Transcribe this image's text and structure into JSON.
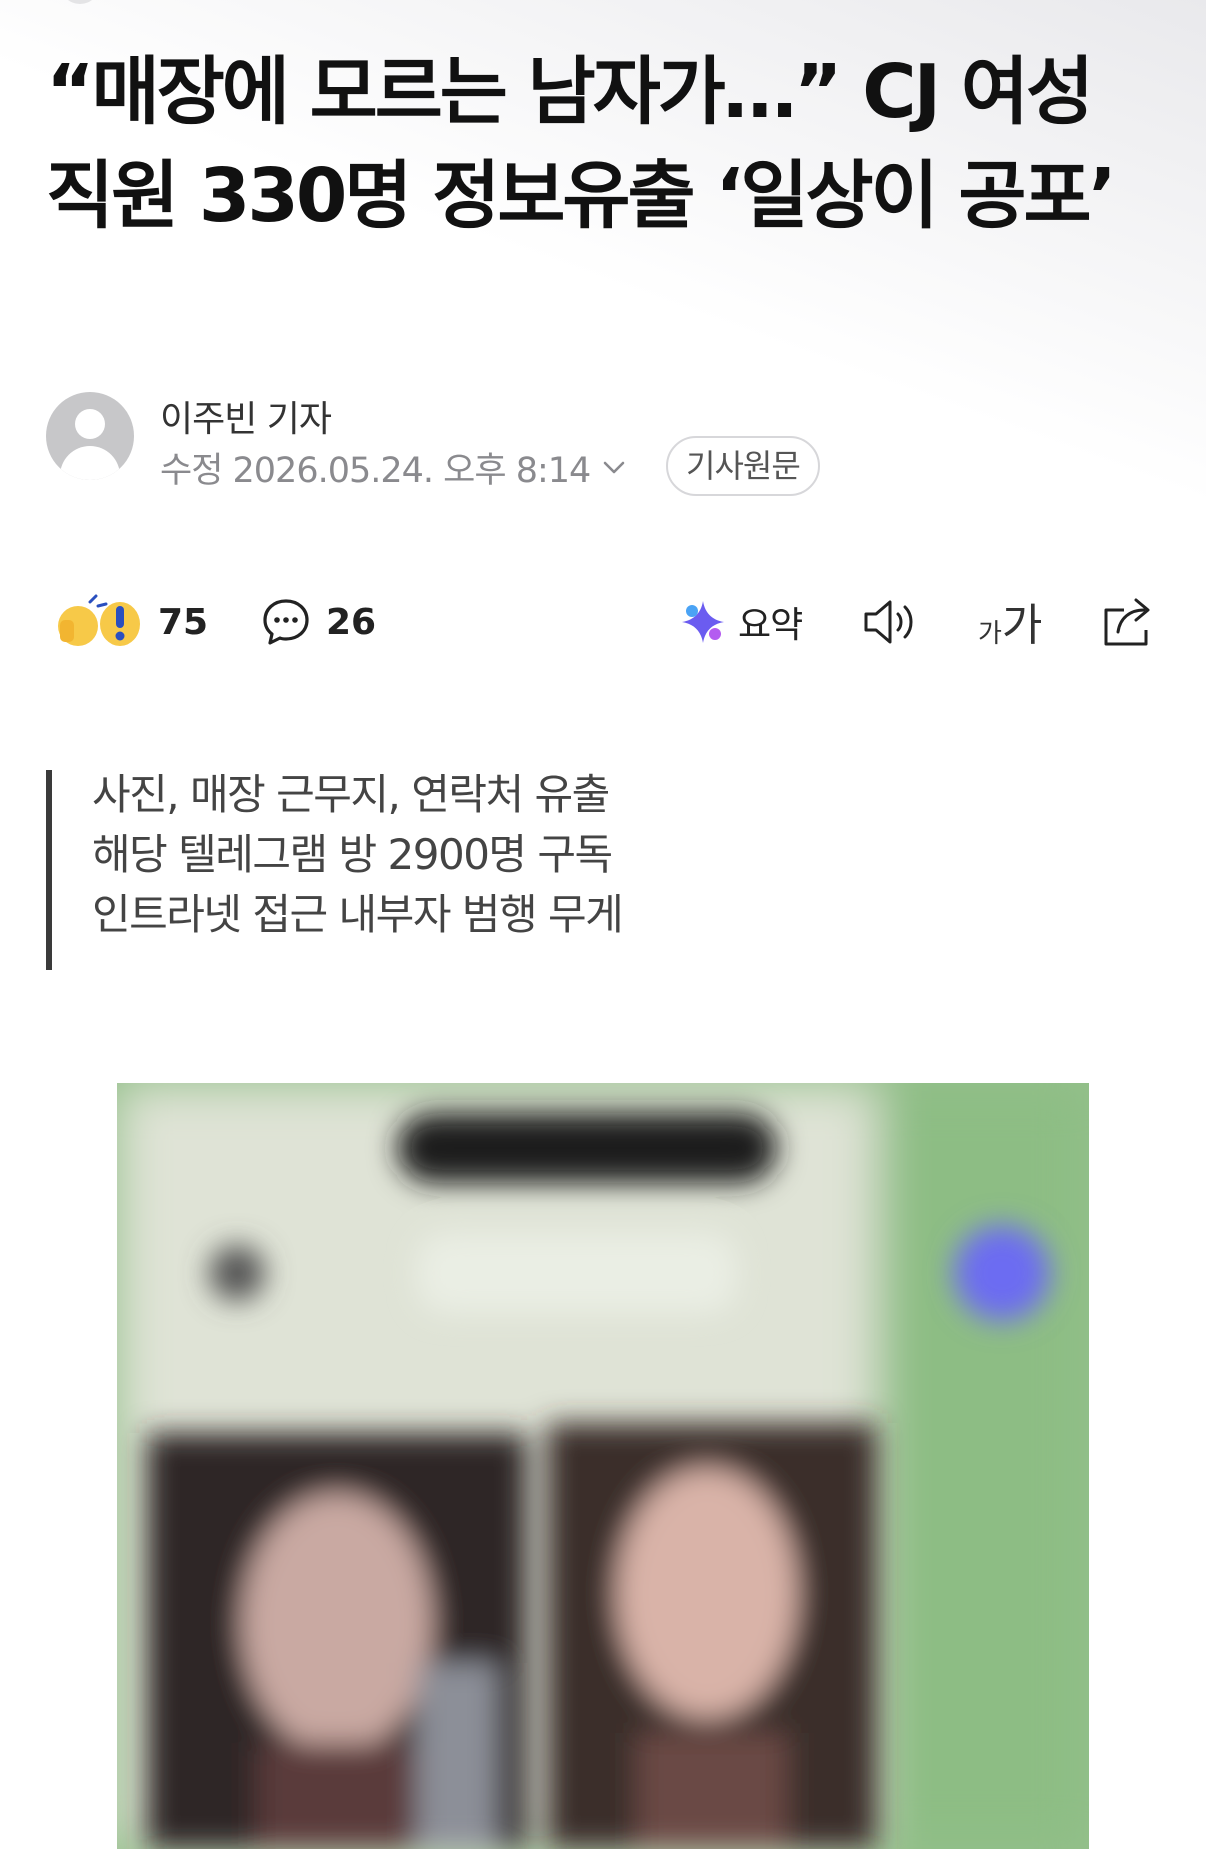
{
  "article": {
    "headline": "“매장에 모르는 남자가…” CJ 여성 직원 330명 정보유출 ‘일상이 공포’",
    "reporter": "이주빈 기자",
    "date": "수정 2026.05.24. 오후 8:14",
    "source_button": "기사원문"
  },
  "actions": {
    "reaction_count": "75",
    "comment_count": "26",
    "summary_label": "요약",
    "font_small": "가",
    "font_big": "가"
  },
  "summary": {
    "lines": [
      "사진, 매장 근무지, 연락처 유출",
      "해당 텔레그램 방 2900명 구독",
      "인트라넷 접근 내부자 범행 무게"
    ]
  },
  "colors": {
    "accent_purple": "#6b5cf0",
    "photo_green": "#8fbf86",
    "muted_text": "#8a8a8e"
  },
  "icons": {
    "reaction": "reaction-emoji-icon",
    "comment": "speech-bubble-icon",
    "summary": "ai-sparkle-icon",
    "audio": "speaker-icon",
    "share": "share-icon",
    "chevron": "chevron-down-icon"
  }
}
